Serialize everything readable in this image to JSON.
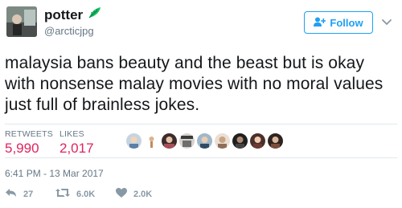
{
  "user": {
    "display_name": "potter",
    "handle": "@arcticjpg"
  },
  "follow_button": {
    "label": "Follow"
  },
  "tweet": {
    "text": "malaysia bans beauty and the beast but is okay with nonsense malay movies with no moral values just full of brainless jokes.",
    "timestamp": "6:41 PM - 13 Mar 2017"
  },
  "stats": {
    "retweets_label": "RETWEETS",
    "retweets_value": "5,990",
    "likes_label": "LIKES",
    "likes_value": "2,017"
  },
  "actions": {
    "reply_count": "27",
    "retweet_count": "6.0K",
    "like_count": "2.0K"
  },
  "likers": [
    "liker-avatar-1",
    "liker-avatar-2",
    "liker-avatar-3",
    "liker-avatar-4",
    "liker-avatar-5",
    "liker-avatar-6",
    "liker-avatar-7",
    "liker-avatar-8",
    "liker-avatar-9"
  ],
  "colors": {
    "accent_blue": "#1da1f2",
    "like_pink": "#e0245e",
    "leaf_green": "#17bf63",
    "muted_gray": "#657786"
  },
  "icons": [
    "person-add-icon",
    "chevron-down-icon",
    "leaf-emoji-icon",
    "reply-icon",
    "retweet-icon",
    "heart-icon"
  ]
}
